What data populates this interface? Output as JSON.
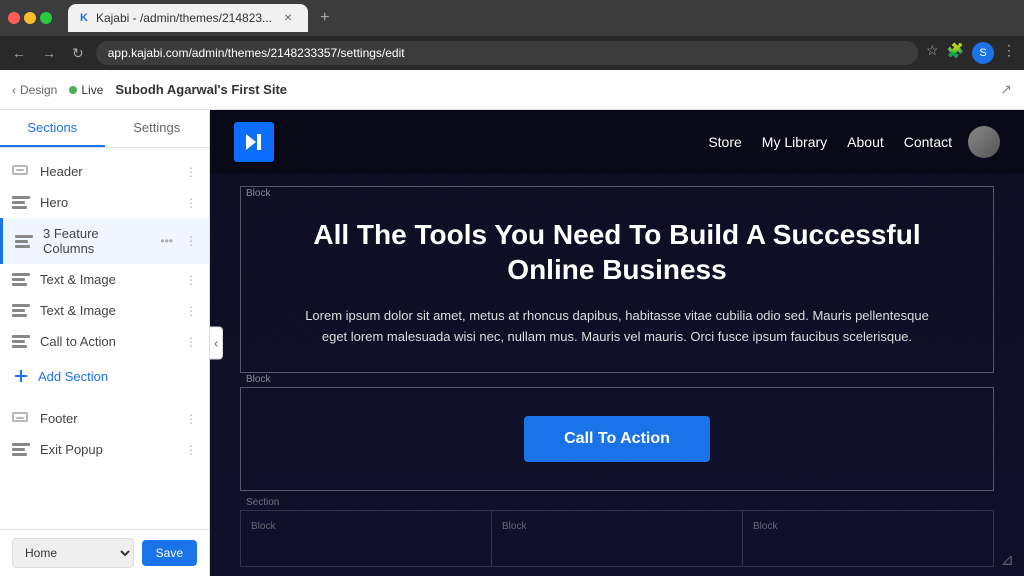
{
  "browser": {
    "tab_title": "Kajabi - /admin/themes/214823...",
    "favicon": "K",
    "address": "app.kajabi.com/admin/themes/2148233357/settings/edit"
  },
  "admin_bar": {
    "design_label": "Design",
    "live_label": "Live",
    "site_name": "Subodh Agarwal's First Site"
  },
  "sidebar": {
    "tab_sections": "Sections",
    "tab_settings": "Settings",
    "items": [
      {
        "id": "header",
        "label": "Header",
        "icon": "header-icon"
      },
      {
        "id": "hero",
        "label": "Hero",
        "icon": "layers-icon"
      },
      {
        "id": "3-feature-columns",
        "label": "3 Feature Columns",
        "icon": "layers-icon",
        "active": true
      },
      {
        "id": "text-image-1",
        "label": "Text & Image",
        "icon": "layers-icon"
      },
      {
        "id": "text-image-2",
        "label": "Text & Image",
        "icon": "layers-icon"
      },
      {
        "id": "call-to-action",
        "label": "Call to Action",
        "icon": "layers-icon"
      }
    ],
    "add_section_label": "Add Section",
    "footer_items": [
      {
        "id": "footer",
        "label": "Footer",
        "icon": "footer-icon"
      },
      {
        "id": "exit-popup",
        "label": "Exit Popup",
        "icon": "layers-icon"
      }
    ],
    "home_options": [
      "Home"
    ],
    "save_label": "Save"
  },
  "preview": {
    "site_nav": [
      {
        "label": "Store"
      },
      {
        "label": "My Library"
      },
      {
        "label": "About"
      },
      {
        "label": "Contact"
      }
    ],
    "hero": {
      "block_label_1": "Block",
      "title": "All The Tools You Need To Build A Successful Online Business",
      "description": "Lorem ipsum dolor sit amet, metus at rhoncus dapibus, habitasse vitae cubilia odio sed. Mauris pellentesque eget lorem malesuada wisi nec, nullam mus. Mauris vel mauris. Orci fusce ipsum faucibus scelerisque.",
      "block_label_2": "Block",
      "cta_label": "Call To Action"
    },
    "section_label": "Section",
    "blocks": [
      {
        "label": "Block"
      },
      {
        "label": "Block"
      },
      {
        "label": "Block"
      }
    ]
  }
}
